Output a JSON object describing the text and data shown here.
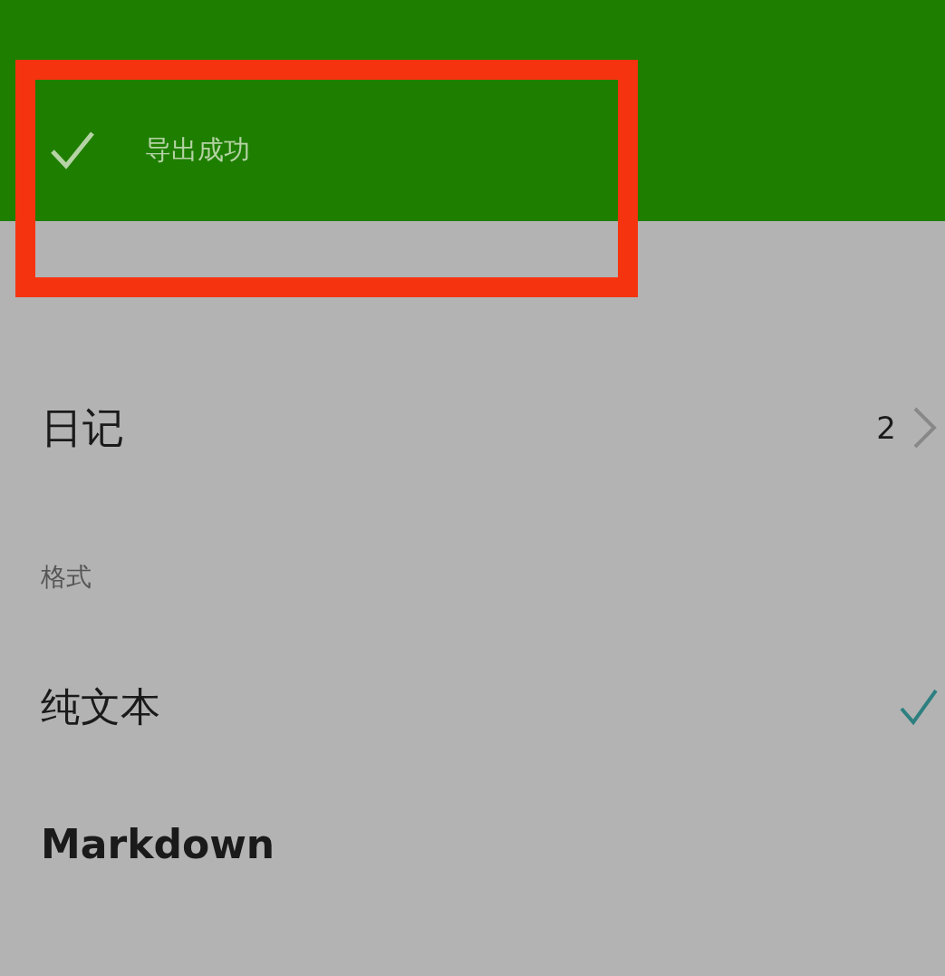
{
  "toast": {
    "message": "导出成功"
  },
  "sections": [
    {
      "items": [
        {
          "kind": "link",
          "label": "日记",
          "count": "2"
        }
      ]
    },
    {
      "header": "格式",
      "items": [
        {
          "kind": "option",
          "label": "纯文本",
          "selected": true
        },
        {
          "kind": "option",
          "label": "Markdown",
          "selected": false
        }
      ]
    }
  ]
}
